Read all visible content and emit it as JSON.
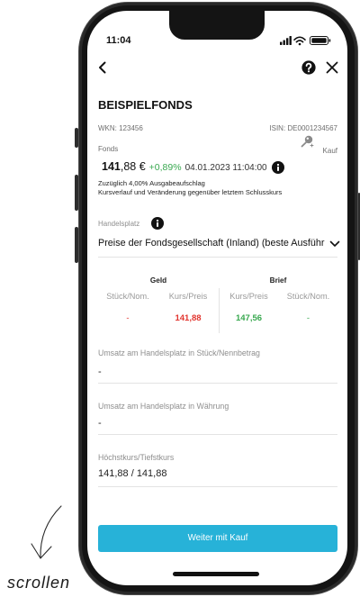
{
  "status_bar": {
    "time": "11:04",
    "icons": [
      "signal-icon",
      "wifi-icon",
      "battery-icon"
    ]
  },
  "header": {
    "back_icon": "chevron-left-icon",
    "help_icon": "question-circle-icon",
    "close_icon": "close-icon"
  },
  "fund": {
    "name": "BEISPIELFONDS",
    "wkn": "WKN: 123456",
    "isin": "ISIN: DE0001234567",
    "category": "Fonds",
    "order_type": "Kauf",
    "order_type_icon": "pin-icon",
    "price_integer": "141",
    "price_fraction": ",88 €",
    "change": "+0,89%",
    "timestamp": "04.01.2023 11:04:00",
    "info_icon": "info-circle-icon",
    "notes": [
      "Zuzüglich 4,00% Ausgabeaufschlag",
      "Kursverlauf und Veränderung gegenüber letztem Schlusskurs"
    ]
  },
  "trading_venue": {
    "label": "Handelsplatz",
    "info_icon": "info-circle-icon",
    "selected": "Preise der Fondsgesellschaft (Inland) (beste Ausführ",
    "dropdown_icon": "chevron-down-icon"
  },
  "quotes": {
    "bid": {
      "title": "Geld",
      "quantity_label": "Stück/Nom.",
      "price_label": "Kurs/Preis",
      "quantity": "-",
      "price": "141,88"
    },
    "ask": {
      "title": "Brief",
      "price_label": "Kurs/Preis",
      "quantity_label": "Stück/Nom.",
      "price": "147,56",
      "quantity": "-"
    }
  },
  "stats": [
    {
      "label": "Umsatz am Handelsplatz in Stück/Nennbetrag",
      "value": "-"
    },
    {
      "label": "Umsatz am Handelsplatz in Währung",
      "value": "-"
    },
    {
      "label": "Höchstkurs/Tiefstkurs",
      "value": "141,88 / 141,88"
    }
  ],
  "cta": {
    "label": "Weiter mit Kauf"
  },
  "annotation": {
    "text": "scrollen",
    "icon": "curved-arrow-down-icon"
  },
  "colors": {
    "accent": "#27b2d8",
    "positive": "#38a84f",
    "negative": "#e2352f",
    "text": "#1c1c1c",
    "muted": "#8e8e8e",
    "divider": "#e3e3e3"
  }
}
